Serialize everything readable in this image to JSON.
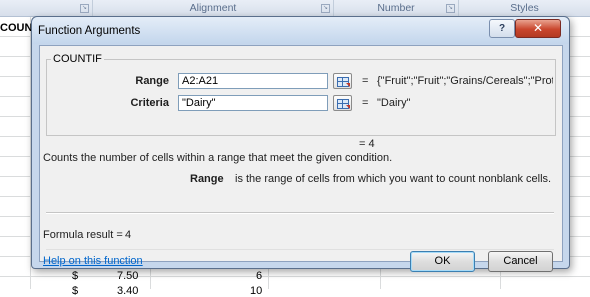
{
  "ribbon": {
    "groups": [
      {
        "label": ""
      },
      {
        "label": "Alignment"
      },
      {
        "label": "Number"
      },
      {
        "label": "Styles"
      }
    ]
  },
  "sheet": {
    "cut_header_text": "COUN",
    "visible_cells": [
      {
        "currency": "$",
        "amount": "7.50",
        "count": "6"
      },
      {
        "currency": "$",
        "amount": "3.40",
        "count": "10"
      }
    ]
  },
  "dialog": {
    "title": "Function Arguments",
    "help_glyph": "?",
    "close_glyph": "✕",
    "function_name": "COUNTIF",
    "args": [
      {
        "label": "Range",
        "value": "A2:A21",
        "result": "{\"Fruit\";\"Fruit\";\"Grains/Cereals\";\"Protein"
      },
      {
        "label": "Criteria",
        "value": "\"Dairy\"",
        "result": "\"Dairy\""
      }
    ],
    "equals": "=",
    "function_result": "= 4",
    "description": "Counts the number of cells within a range that meet the given condition.",
    "arg_help_name": "Range",
    "arg_help_text": "is the range of cells from which you want to count nonblank cells.",
    "formula_result_label": "Formula result =",
    "formula_result_value": "4",
    "help_link": "Help on this function",
    "ok_label": "OK",
    "cancel_label": "Cancel"
  }
}
